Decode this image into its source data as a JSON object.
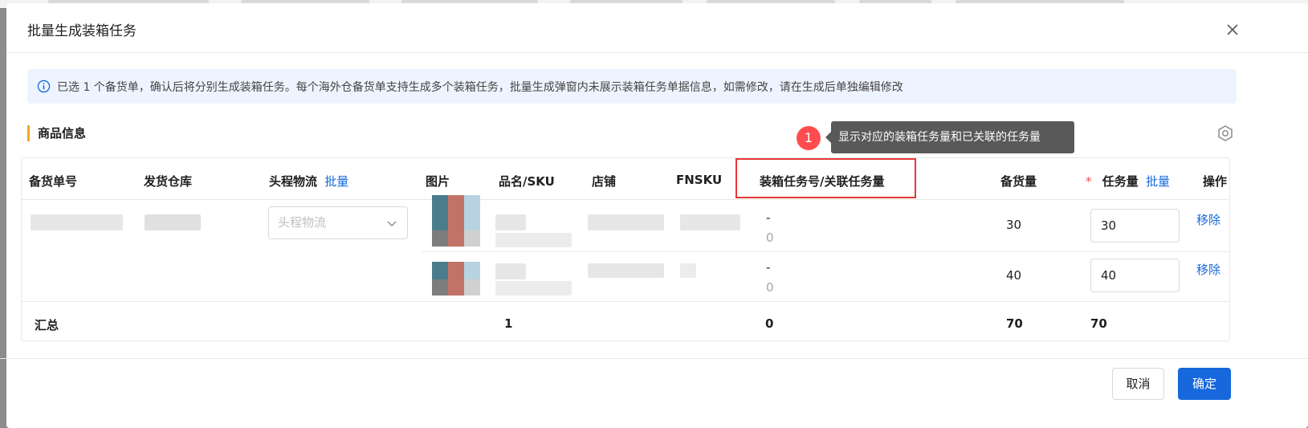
{
  "modal": {
    "title": "批量生成装箱任务",
    "alert": "已选 1 个备货单，确认后将分别生成装箱任务。每个海外仓备货单支持生成多个装箱任务，批量生成弹窗内未展示装箱任务单据信息，如需修改，请在生成后单独编辑修改",
    "section_title": "商品信息",
    "tooltip": {
      "badge": "1",
      "text": "显示对应的装箱任务量和已关联的任务量"
    }
  },
  "table": {
    "columns": {
      "order_no": "备货单号",
      "warehouse": "发货仓库",
      "logistics": "头程物流",
      "logistics_batch": "批量",
      "image": "图片",
      "name_sku": "品名/SKU",
      "shop": "店铺",
      "fnsku": "FNSKU",
      "task_linked": "装箱任务号/关联任务量",
      "stock_qty": "备货量",
      "required_mark": "*",
      "task_qty": "任务量",
      "task_qty_batch": "批量",
      "action": "操作"
    },
    "logistics_placeholder": "头程物流",
    "rows": [
      {
        "task_no": "-",
        "linked_qty": "0",
        "stock_qty": "30",
        "task_qty": "30",
        "action": "移除"
      },
      {
        "task_no": "-",
        "linked_qty": "0",
        "stock_qty": "40",
        "task_qty": "40",
        "action": "移除"
      }
    ],
    "summary": {
      "label": "汇总",
      "name_sku": "1",
      "task_linked": "0",
      "stock_qty": "70",
      "task_qty": "70"
    }
  },
  "footer": {
    "cancel": "取消",
    "ok": "确定"
  }
}
